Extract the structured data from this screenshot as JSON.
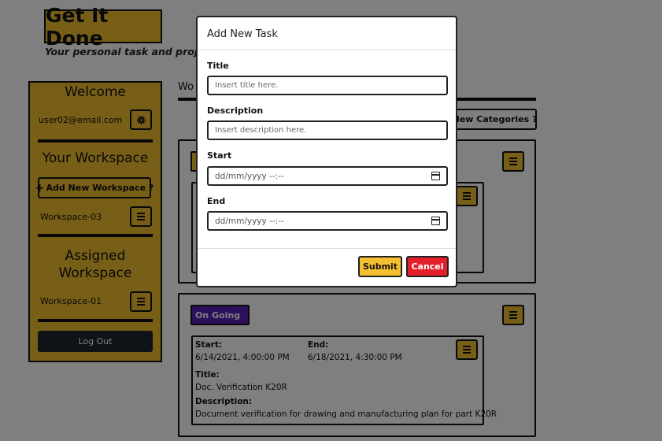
{
  "brand": {
    "title": "Get It Done",
    "tagline": "Your personal task and project m"
  },
  "sidebar": {
    "welcome": "Welcome",
    "email": "user02@email.com",
    "workspace_heading": "Your Workspace",
    "add_workspace": "Add New Workspace ?",
    "workspaces": [
      "Workspace-03"
    ],
    "assigned_heading_line1": "Assigned",
    "assigned_heading_line2": "Workspace",
    "assigned": [
      "Workspace-01"
    ],
    "logout": "Log Out"
  },
  "main": {
    "tab": "Wo",
    "new_categories": "New Categories ?",
    "cards": [
      {
        "status": "",
        "status_color": "#f0be2e"
      },
      {
        "status": "On Going",
        "status_color": "#5b21b6",
        "task": {
          "start_label": "Start:",
          "start_value": "6/14/2021, 4:00:00 PM",
          "end_label": "End:",
          "end_value": "6/18/2021, 4:30:00 PM",
          "title_label": "Title:",
          "title_value": "Doc. Verification K20R",
          "description_label": "Description:",
          "description_value": "Document verification for drawing and manufacturing plan for part K20R"
        }
      }
    ]
  },
  "modal": {
    "title": "Add New Task",
    "fields": {
      "title_label": "Title",
      "title_placeholder": "Insert title here.",
      "description_label": "Description",
      "description_placeholder": "Insert description here.",
      "start_label": "Start",
      "start_value": "dd/mm/yyyy --:--",
      "end_label": "End",
      "end_value": "dd/mm/yyyy --:--"
    },
    "submit": "Submit",
    "cancel": "Cancel"
  },
  "colors": {
    "accent": "#f0be2e",
    "submit": "#f5c02f",
    "cancel": "#e3202a",
    "dark": "#1e252d",
    "ongoing": "#5b21b6"
  },
  "icons": {
    "gear": "gear-icon",
    "menu": "hamburger-icon",
    "calendar": "calendar-icon",
    "plus": "plus-icon"
  }
}
